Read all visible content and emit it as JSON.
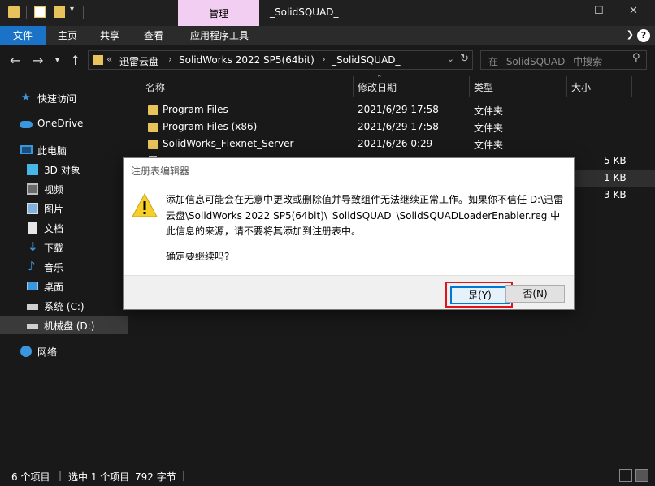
{
  "window": {
    "context_tab": "管理",
    "title": "_SolidSQUAD_"
  },
  "ribbon": {
    "tabs": [
      "文件",
      "主页",
      "共享",
      "查看",
      "应用程序工具"
    ]
  },
  "address": {
    "crumbs": [
      "迅雷云盘",
      "SolidWorks 2022 SP5(64bit)",
      "_SolidSQUAD_"
    ],
    "search_placeholder": "在 _SolidSQUAD_ 中搜索"
  },
  "nav": {
    "items": [
      {
        "label": "快速访问",
        "icon": "star-icon"
      },
      {
        "label": "OneDrive",
        "icon": "cloud-icon"
      },
      {
        "label": "此电脑",
        "icon": "computer-icon"
      },
      {
        "label": "3D 对象",
        "icon": "cube-icon"
      },
      {
        "label": "视频",
        "icon": "video-icon"
      },
      {
        "label": "图片",
        "icon": "picture-icon"
      },
      {
        "label": "文档",
        "icon": "document-icon"
      },
      {
        "label": "下载",
        "icon": "download-icon"
      },
      {
        "label": "音乐",
        "icon": "music-icon"
      },
      {
        "label": "桌面",
        "icon": "desktop-icon"
      },
      {
        "label": "系统 (C:)",
        "icon": "drive-icon"
      },
      {
        "label": "机械盘 (D:)",
        "icon": "drive-icon"
      },
      {
        "label": "网络",
        "icon": "network-icon"
      }
    ]
  },
  "list": {
    "columns": [
      "名称",
      "修改日期",
      "类型",
      "大小"
    ],
    "rows": [
      {
        "name": "Program Files",
        "date": "2021/6/29 17:58",
        "type": "文件夹",
        "size": ""
      },
      {
        "name": "Program Files (x86)",
        "date": "2021/6/29 17:58",
        "type": "文件夹",
        "size": ""
      },
      {
        "name": "SolidWorks_Flexnet_Server",
        "date": "2021/6/26 0:29",
        "type": "文件夹",
        "size": ""
      },
      {
        "name": "",
        "date": "",
        "type": "",
        "size": "5 KB"
      },
      {
        "name": "",
        "date": "",
        "type": "",
        "size": "1 KB"
      },
      {
        "name": "",
        "date": "",
        "type": "",
        "size": "3 KB"
      }
    ]
  },
  "status": {
    "count": "6 个项目",
    "selection": "选中 1 个项目",
    "size": "792 字节"
  },
  "dialog": {
    "title": "注册表编辑器",
    "message": "添加信息可能会在无意中更改或删除值并导致组件无法继续正常工作。如果你不信任 D:\\迅雷云盘\\SolidWorks 2022 SP5(64bit)\\_SolidSQUAD_\\SolidSQUADLoaderEnabler.reg 中此信息的来源，请不要将其添加到注册表中。",
    "question": "确定要继续吗?",
    "yes_label": "是(Y)",
    "no_label": "否(N)"
  },
  "colors": {
    "accent": "#1a73c7",
    "context_tab": "#f2cef2",
    "folder": "#e8c25a",
    "highlight": "#e0151b"
  }
}
